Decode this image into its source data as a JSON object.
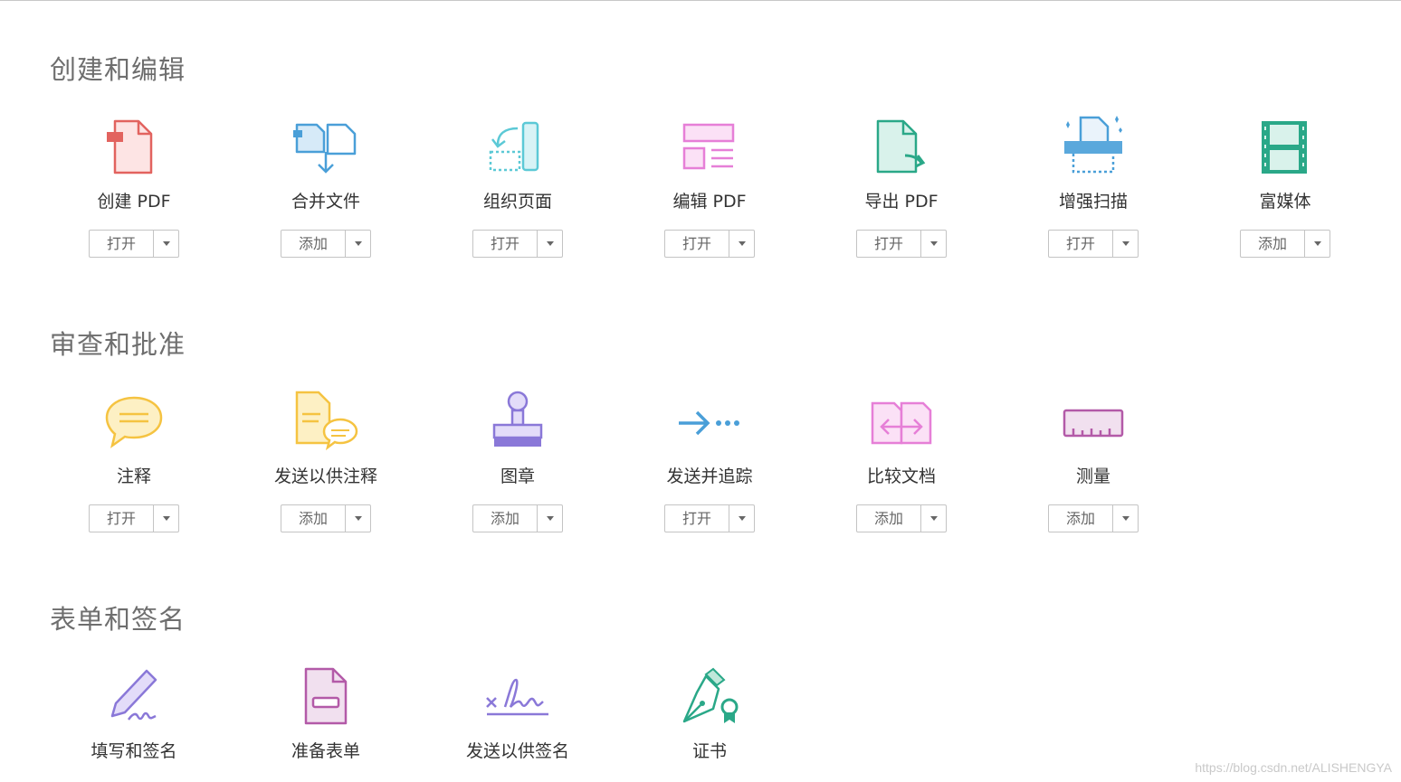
{
  "sections": [
    {
      "title": "创建和编辑",
      "tools": [
        {
          "label": "创建 PDF",
          "button": "打开",
          "icon": "create-pdf-icon"
        },
        {
          "label": "合并文件",
          "button": "添加",
          "icon": "combine-files-icon"
        },
        {
          "label": "组织页面",
          "button": "打开",
          "icon": "organize-pages-icon"
        },
        {
          "label": "编辑 PDF",
          "button": "打开",
          "icon": "edit-pdf-icon"
        },
        {
          "label": "导出 PDF",
          "button": "打开",
          "icon": "export-pdf-icon"
        },
        {
          "label": "增强扫描",
          "button": "打开",
          "icon": "enhance-scan-icon"
        },
        {
          "label": "富媒体",
          "button": "添加",
          "icon": "rich-media-icon"
        }
      ]
    },
    {
      "title": "审查和批准",
      "tools": [
        {
          "label": "注释",
          "button": "打开",
          "icon": "comment-icon"
        },
        {
          "label": "发送以供注释",
          "button": "添加",
          "icon": "send-for-comments-icon"
        },
        {
          "label": "图章",
          "button": "添加",
          "icon": "stamp-icon"
        },
        {
          "label": "发送并追踪",
          "button": "打开",
          "icon": "send-and-track-icon"
        },
        {
          "label": "比较文档",
          "button": "添加",
          "icon": "compare-documents-icon"
        },
        {
          "label": "测量",
          "button": "添加",
          "icon": "measure-icon"
        }
      ]
    },
    {
      "title": "表单和签名",
      "tools": [
        {
          "label": "填写和签名",
          "icon": "fill-and-sign-icon"
        },
        {
          "label": "准备表单",
          "icon": "prepare-form-icon"
        },
        {
          "label": "发送以供签名",
          "icon": "send-for-signature-icon"
        },
        {
          "label": "证书",
          "icon": "certificates-icon"
        }
      ]
    }
  ],
  "watermark": "https://blog.csdn.net/ALISHENGYA"
}
